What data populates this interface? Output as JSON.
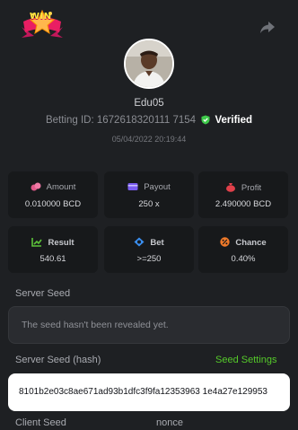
{
  "header": {
    "badge_text": "WIN"
  },
  "user": {
    "name": "Edu05",
    "betting_id_label": "Betting ID:",
    "betting_id": "1672618320111 7154",
    "verified_label": "Verified",
    "datetime": "05/04/2022 20:19:44"
  },
  "stats": {
    "amount": {
      "label": "Amount",
      "value": "0.010000 BCD"
    },
    "payout": {
      "label": "Payout",
      "value": "250 x"
    },
    "profit": {
      "label": "Profit",
      "value": "2.490000 BCD"
    },
    "result": {
      "label": "Result",
      "value": "540.61"
    },
    "bet": {
      "label": "Bet",
      "value": ">=250"
    },
    "chance": {
      "label": "Chance",
      "value": "0.40%"
    }
  },
  "server_seed": {
    "label": "Server Seed",
    "value": "The seed hasn't been revealed yet."
  },
  "server_seed_hash": {
    "label": "Server Seed (hash)",
    "settings_label": "Seed Settings",
    "value": "8101b2e03c8ae671ad93b1dfc3f9fa12353963 1e4a27e129953"
  },
  "client_seed": {
    "label": "Client Seed",
    "nonce_label": "nonce"
  },
  "colors": {
    "background": "#1e2023",
    "card": "#17191b",
    "accent_green": "#55c92a",
    "amount_icon": "#e05a8a",
    "payout_icon": "#7a5cf0",
    "profit_icon": "#e0404a",
    "result_icon": "#5cc23a",
    "bet_icon": "#3a8ff0",
    "chance_icon": "#f07a2a"
  },
  "icons": [
    "win-badge",
    "share-icon",
    "avatar",
    "shield-check-icon",
    "coins-icon",
    "card-icon",
    "money-bag-icon",
    "chart-icon",
    "target-icon",
    "percent-icon"
  ]
}
